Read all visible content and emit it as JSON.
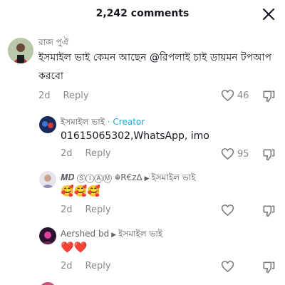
{
  "header": {
    "title": "2,242 comments"
  },
  "comments": [
    {
      "username": "রাজ পুঐ",
      "text_line1": "ইসমাইল ভাই কেমন আছেন @রিপলাই চাই ডায়মন টপআপ",
      "text_line2": "করবো",
      "time": "2d",
      "reply_label": "Reply",
      "likes": "46"
    },
    {
      "username": "ইসমাইল ভাই",
      "badge": " · Creator",
      "text": "01615065302,WhatsApp, imo",
      "time": "2d",
      "reply_label": "Reply",
      "likes": "95"
    },
    {
      "username": "𝑴𝑫 ⓈⒾⒶⓂ ☬R€z∆",
      "reply_to": "ইসমাইল ভাই",
      "emojis": "🥰🥰🥰",
      "time": "2d",
      "reply_label": "Reply"
    },
    {
      "username": "Aershed bd",
      "reply_to": "ইসমাইল ভাই",
      "emojis": "❤️❤️",
      "time": "2d",
      "reply_label": "Reply"
    }
  ]
}
